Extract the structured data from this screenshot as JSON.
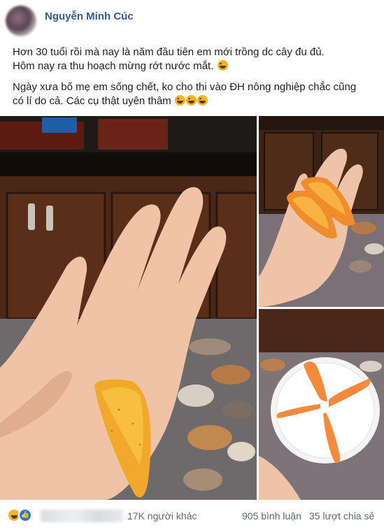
{
  "post": {
    "author": "Nguyễn Minh Cúc",
    "paragraph1": {
      "line1": "Hơn 30 tuổi rồi mà nay là năm đầu tiên em mới trồng dc cây đu đủ.",
      "line2": "Hôm nay ra thu hoạch mừng rớt nước mắt."
    },
    "paragraph2": {
      "line1": "Ngày xưa bố mẹ em sống chết, ko cho thi vào ĐH nông nghiệp chắc cũng",
      "line2": "có lí do cả. Các cụ thật uyên thâm"
    },
    "emoji_name": "laughing-tears-emoji"
  },
  "photos": [
    {
      "name": "hand-holding-small-papaya-photo"
    },
    {
      "name": "papaya-halves-on-hand-photo"
    },
    {
      "name": "papaya-slices-on-plate-photo"
    }
  ],
  "reactions": {
    "icons": [
      "haha-icon",
      "like-icon"
    ],
    "others_count": "17K người khác",
    "comments": "905 bình luận",
    "shares": "35 lượt chia sẻ"
  },
  "colors": {
    "author_link": "#385898",
    "secondary_text": "#606770",
    "like_blue": "#1877f2",
    "emoji_yellow": "#f7b125"
  }
}
